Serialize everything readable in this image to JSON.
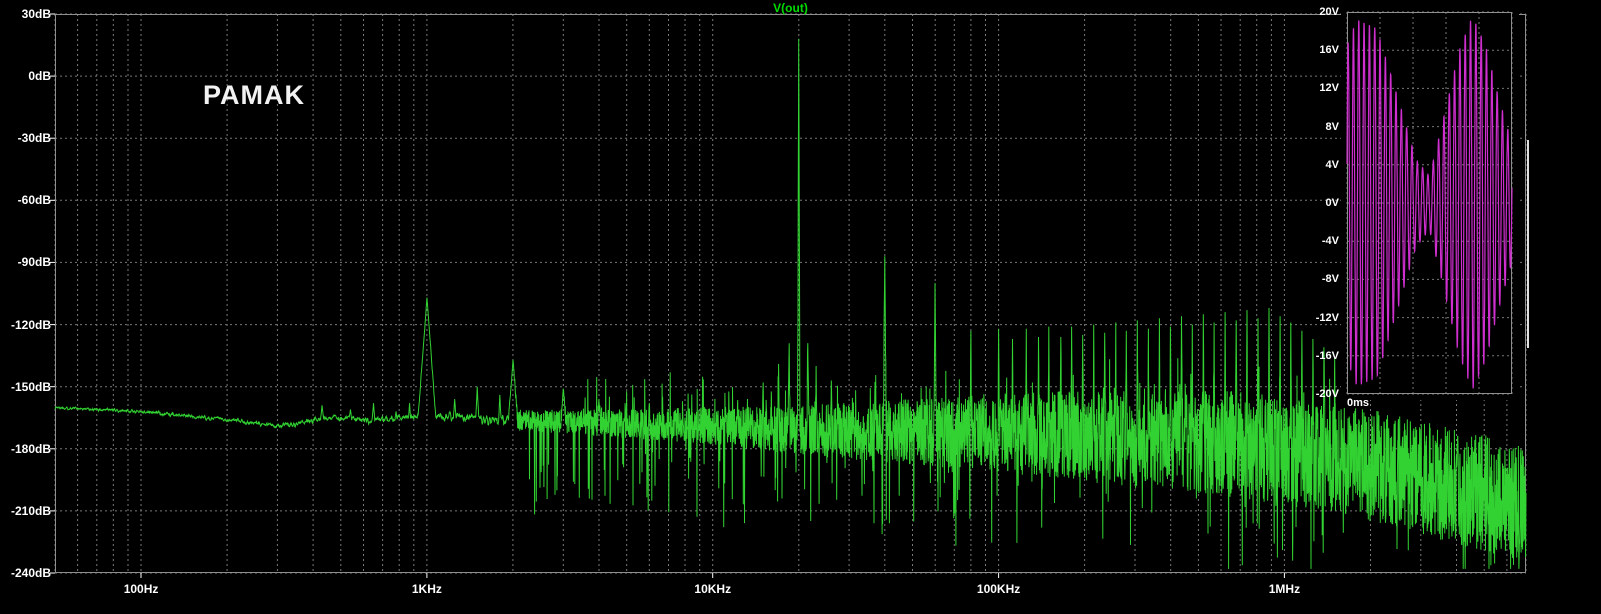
{
  "chart_data": [
    {
      "type": "line",
      "name": "fft-spectrum",
      "title": "V(out)",
      "annotation": "PAMAK",
      "x_scale": "log",
      "x_range_hz": [
        50,
        7000000
      ],
      "ylim_db": [
        -240,
        30
      ],
      "xticks": [
        {
          "value": 100,
          "label": "100Hz"
        },
        {
          "value": 1000,
          "label": "1KHz"
        },
        {
          "value": 10000,
          "label": "10KHz"
        },
        {
          "value": 100000,
          "label": "100KHz"
        },
        {
          "value": 1000000,
          "label": "1MHz"
        }
      ],
      "yticks": [
        {
          "value": 30,
          "label": "30dB"
        },
        {
          "value": 0,
          "label": "0dB"
        },
        {
          "value": -30,
          "label": "-30dB"
        },
        {
          "value": -60,
          "label": "-60dB"
        },
        {
          "value": -90,
          "label": "-90dB"
        },
        {
          "value": -120,
          "label": "-120dB"
        },
        {
          "value": -150,
          "label": "-150dB"
        },
        {
          "value": -180,
          "label": "-180dB"
        },
        {
          "value": -210,
          "label": "-210dB"
        },
        {
          "value": -240,
          "label": "-240dB"
        }
      ],
      "colors": {
        "trace": "#32d232",
        "title": "#00dd00",
        "grid": "#787878",
        "axis_text": "#ffffff",
        "annotation": "#f2f2f2",
        "background": "#000000"
      },
      "noise_envelope": [
        [
          50,
          -160,
          1.2
        ],
        [
          100,
          -162,
          1.5
        ],
        [
          200,
          -166,
          1.8
        ],
        [
          300,
          -169,
          2.0
        ],
        [
          450,
          -165,
          2.2
        ],
        [
          650,
          -166,
          2.5
        ],
        [
          900,
          -164,
          3.0
        ],
        [
          1000,
          -164,
          3.5
        ],
        [
          2000,
          -166,
          5.0
        ],
        [
          5000,
          -168,
          7.0
        ],
        [
          10000,
          -169,
          9.0
        ],
        [
          20000,
          -171,
          12.0
        ],
        [
          50000,
          -172,
          16.0
        ],
        [
          100000,
          -172,
          19.0
        ],
        [
          200000,
          -174,
          22.0
        ],
        [
          400000,
          -176,
          24.0
        ],
        [
          700000,
          -178,
          26.0
        ],
        [
          1000000,
          -181,
          26.0
        ],
        [
          2000000,
          -188,
          27.0
        ],
        [
          3500000,
          -196,
          28.0
        ],
        [
          5600000,
          -203,
          28.0
        ],
        [
          7000000,
          -207,
          28.0
        ]
      ],
      "peaks": [
        [
          430,
          -159,
          5
        ],
        [
          540,
          -161,
          4
        ],
        [
          650,
          -158,
          4
        ],
        [
          780,
          -162,
          3
        ],
        [
          870,
          -158,
          3
        ],
        [
          1000,
          -107,
          35
        ],
        [
          1250,
          -156,
          4
        ],
        [
          1500,
          -150,
          5
        ],
        [
          1800,
          -154,
          4
        ],
        [
          2000,
          -137,
          18
        ],
        [
          3000,
          -151,
          10
        ],
        [
          4000,
          -156,
          6
        ],
        [
          6000,
          -158,
          4
        ],
        [
          15000,
          -148,
          2
        ],
        [
          17000,
          -139,
          2
        ],
        [
          18500,
          -129,
          3
        ],
        [
          20000,
          18,
          4
        ],
        [
          21500,
          -129,
          3
        ],
        [
          23000,
          -140,
          2
        ],
        [
          26000,
          -147,
          2
        ],
        [
          40000,
          -87,
          5
        ],
        [
          60000,
          -100,
          4
        ],
        [
          80000,
          -123,
          3
        ],
        [
          100000,
          -122,
          2
        ],
        [
          112000,
          -127,
          2
        ],
        [
          125000,
          -122,
          2
        ],
        [
          138000,
          -126,
          2
        ],
        [
          150000,
          -121,
          2
        ],
        [
          165000,
          -126,
          2
        ],
        [
          180000,
          -121,
          2
        ],
        [
          197000,
          -125,
          2
        ],
        [
          215000,
          -120,
          2
        ],
        [
          235000,
          -124,
          2
        ],
        [
          257000,
          -119,
          2
        ],
        [
          280000,
          -123,
          2
        ],
        [
          306000,
          -118,
          2
        ],
        [
          334000,
          -122,
          2
        ],
        [
          365000,
          -117,
          2
        ],
        [
          399000,
          -121,
          2
        ],
        [
          436000,
          -116,
          2
        ],
        [
          476000,
          -120,
          2
        ],
        [
          520000,
          -115,
          2
        ],
        [
          568000,
          -119,
          2
        ],
        [
          620000,
          -114,
          2
        ],
        [
          678000,
          -118,
          2
        ],
        [
          740000,
          -113,
          2
        ],
        [
          808000,
          -117,
          2
        ],
        [
          883000,
          -112,
          2
        ],
        [
          965000,
          -116,
          2
        ],
        [
          1054000,
          -119,
          2
        ],
        [
          1151000,
          -123,
          2
        ],
        [
          1258000,
          -127,
          2
        ],
        [
          1374000,
          -131,
          2
        ],
        [
          1500000,
          -136,
          2
        ]
      ]
    },
    {
      "type": "line",
      "name": "output-waveform-inset",
      "x_label": "0ms",
      "ylim_v": [
        -20,
        20
      ],
      "yticks": [
        {
          "value": 20,
          "label": "20V"
        },
        {
          "value": 16,
          "label": "16V"
        },
        {
          "value": 12,
          "label": "12V"
        },
        {
          "value": 8,
          "label": "8V"
        },
        {
          "value": 4,
          "label": "4V"
        },
        {
          "value": 0,
          "label": "0V"
        },
        {
          "value": -4,
          "label": "-4V"
        },
        {
          "value": -8,
          "label": "-8V"
        },
        {
          "value": -12,
          "label": "-12V"
        },
        {
          "value": -16,
          "label": "-16V"
        },
        {
          "value": -20,
          "label": "-20V"
        }
      ],
      "colors": {
        "trace": "#cf2fcf",
        "grid": "#787878",
        "axis_text": "#ffffff",
        "background": "#000000"
      },
      "waveform": {
        "carrier_cycles": 31,
        "phase": 0.25,
        "envelope_peak_v": 19.6,
        "envelope_keyframes": [
          [
            0,
            16.5
          ],
          [
            0.06,
            19.2
          ],
          [
            0.18,
            18.3
          ],
          [
            0.3,
            11.5
          ],
          [
            0.42,
            4.5
          ],
          [
            0.5,
            2.8
          ],
          [
            0.58,
            8.5
          ],
          [
            0.68,
            16.0
          ],
          [
            0.76,
            19.6
          ],
          [
            0.84,
            16.5
          ],
          [
            0.92,
            11.0
          ],
          [
            1,
            6.2
          ]
        ]
      }
    }
  ]
}
